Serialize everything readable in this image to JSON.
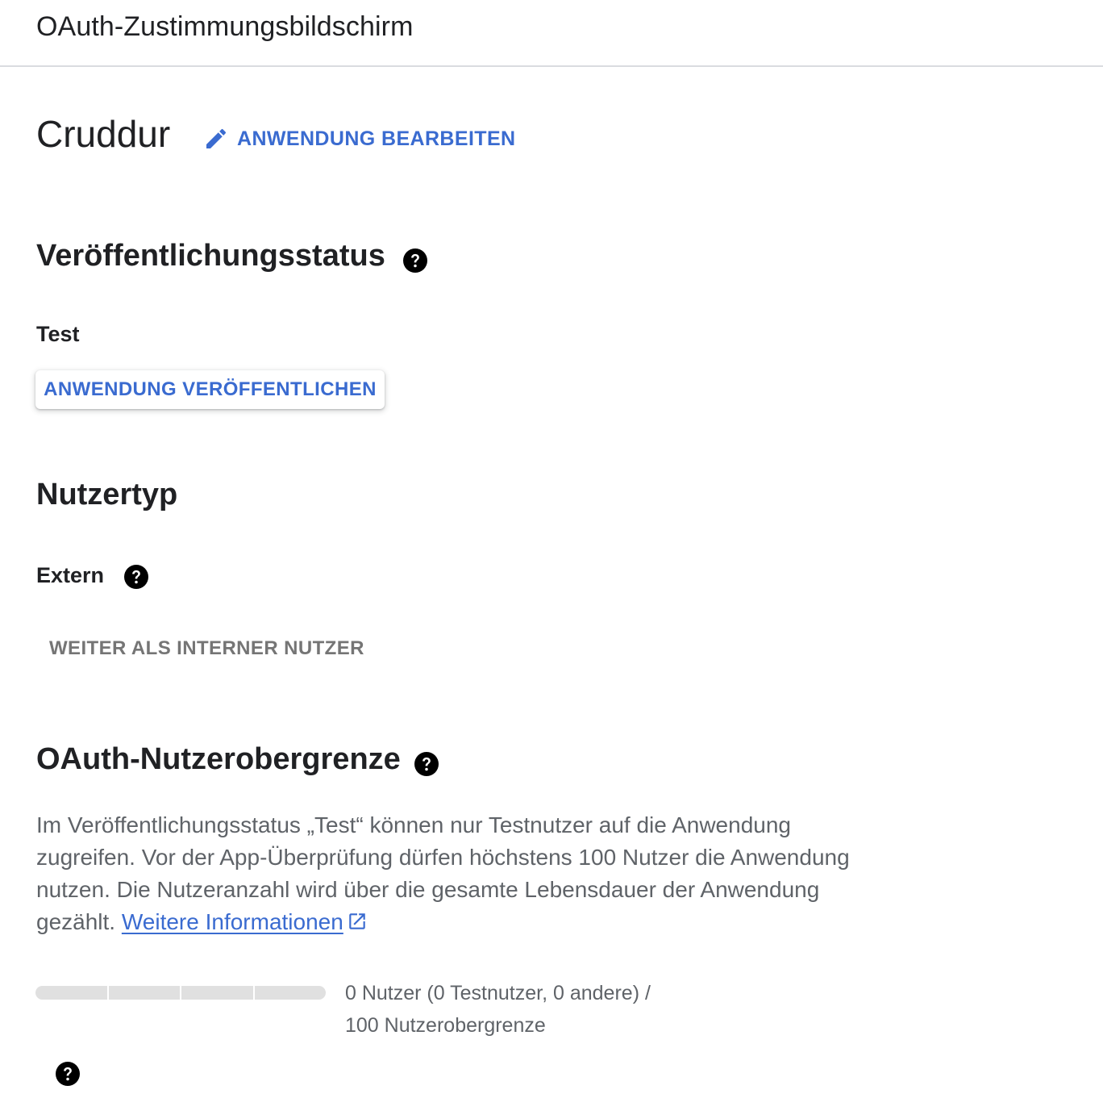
{
  "header": {
    "title": "OAuth-Zustimmungsbildschirm"
  },
  "app": {
    "name": "Cruddur",
    "edit_label": "ANWENDUNG BEARBEITEN"
  },
  "publishing": {
    "heading": "Veröffentlichungsstatus",
    "status": "Test",
    "publish_label": "ANWENDUNG VERÖFFENTLICHEN"
  },
  "user_type": {
    "heading": "Nutzertyp",
    "value": "Extern",
    "switch_label": "WEITER ALS INTERNER NUTZER"
  },
  "user_cap": {
    "heading": "OAuth-Nutzerobergrenze",
    "description": "Im Veröffentlichungsstatus „Test“ können nur Testnutzer auf die Anwendung zugreifen. Vor der App-Überprüfung dürfen höchstens 100 Nutzer die Anwendung nutzen. Die Nutzeranzahl wird über die gesamte Lebensdauer der Anwendung gezählt. ",
    "learn_more": "Weitere Informationen",
    "usage_line1": "0 Nutzer (0 Testnutzer, 0 andere) /",
    "usage_line2": "100 Nutzerobergrenze",
    "used": 0,
    "limit": 100
  },
  "colors": {
    "accent": "#3a6bd0",
    "text": "#202124",
    "muted": "#5f6368",
    "disabled": "#757575",
    "track": "#e0e0e0"
  },
  "icons": {
    "edit": "pencil-icon",
    "help": "help-icon",
    "external": "open-in-new-icon"
  }
}
